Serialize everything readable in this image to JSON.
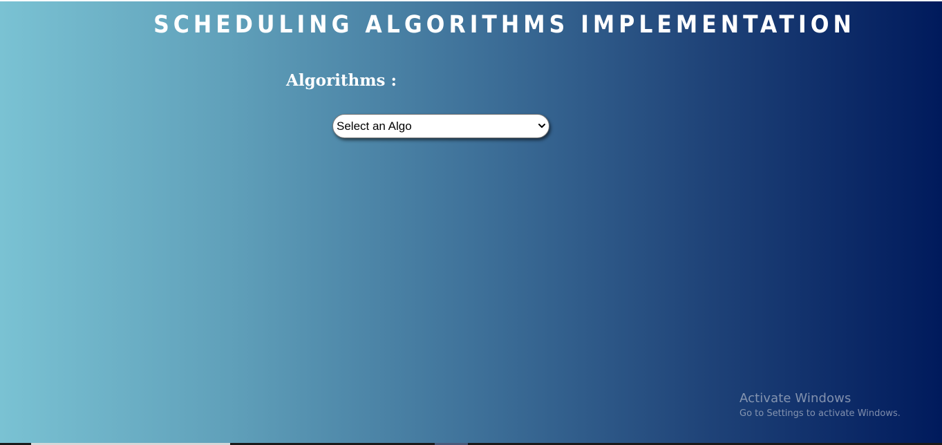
{
  "header": {
    "title": "SCHEDULING ALGORITHMS IMPLEMENTATION"
  },
  "algorithms": {
    "label": "Algorithms :",
    "select": {
      "selected": "Select an Algo",
      "options": [
        "Select an Algo"
      ]
    }
  },
  "watermark": {
    "title": "Activate Windows",
    "subtitle": "Go to Settings to activate Windows."
  },
  "icons": {
    "dropdown": "chevron-down-icon"
  },
  "colors": {
    "gradient_start": "#7ac2d3",
    "gradient_end": "#001a5c",
    "title_text": "#ffffff"
  }
}
